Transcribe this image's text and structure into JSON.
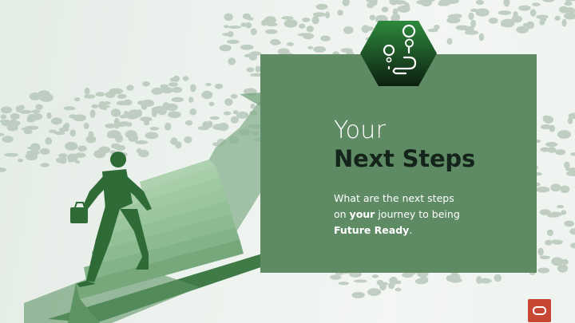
{
  "slide": {
    "title_line1": "Your",
    "title_line2": "Next Steps",
    "body_part1": "What are the next steps",
    "body_part2": "on ",
    "body_bold1": "your",
    "body_part3": " journey to being",
    "body_bold2": "Future Ready",
    "body_part4": "."
  },
  "icons": {
    "badge": "route-pin-icon",
    "logo": "oracle-logo"
  },
  "colors": {
    "panel": "#5e8a64",
    "title_dark": "#14241a",
    "badge_top": "#2e8a3e",
    "badge_bottom": "#0d1f10",
    "brand_red": "#c74634"
  }
}
